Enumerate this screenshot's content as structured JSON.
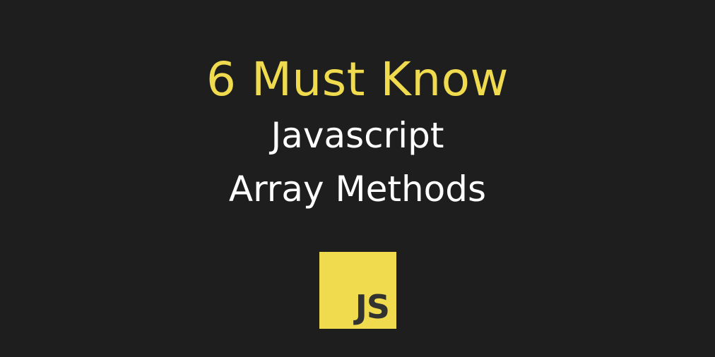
{
  "title": {
    "accent": "6 Must Know",
    "line1": "Javascript",
    "line2": "Array Methods"
  },
  "logo": {
    "icon": "javascript-logo-icon",
    "text": "JS"
  },
  "colors": {
    "background": "#1e1e1e",
    "accent": "#f0db4f",
    "text": "#ffffff",
    "logo_text": "#323330"
  }
}
